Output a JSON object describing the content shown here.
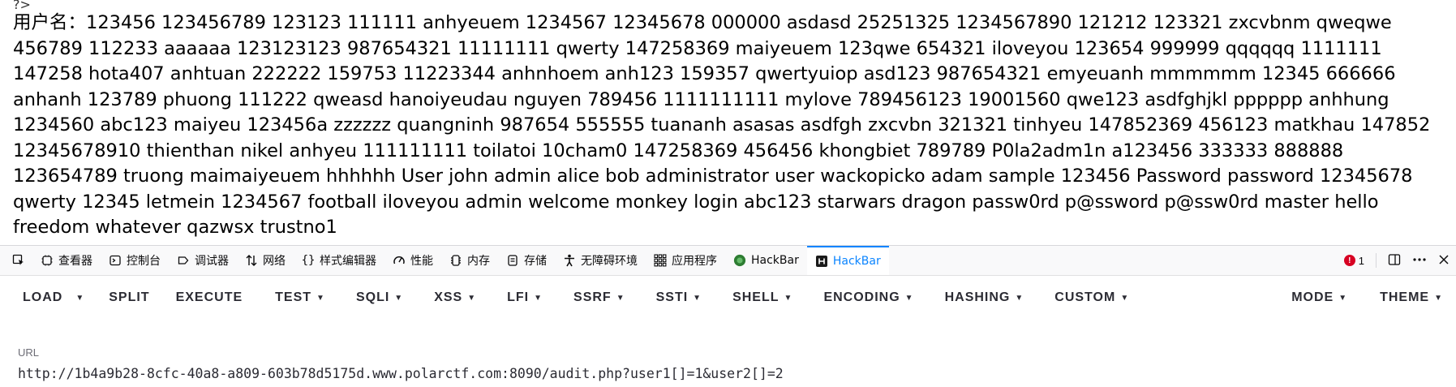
{
  "page": {
    "partial_top_text": "?>",
    "body_text": "用户名：123456 123456789 123123 111111 anhyeuem 1234567 12345678 000000 asdasd 25251325 1234567890 121212 123321 zxcvbnm qweqwe 456789 112233 aaaaaa 123123123 987654321 11111111 qwerty 147258369 maiyeuem 123qwe 654321 iloveyou 123654 999999 qqqqqq 1111111 147258 hota407 anhtuan 222222 159753 11223344 anhnhoem anh123 159357 qwertyuiop asd123 987654321 emyeuanh mmmmmm 12345 666666 anhanh 123789 phuong 111222 qweasd hanoiyeudau nguyen 789456 1111111111 mylove 789456123 19001560 qwe123 asdfghjkl pppppp anhhung 1234560 abc123 maiyeu 123456a zzzzzz quangninh 987654 555555 tuananh asasas asdfgh zxcvbn 321321 tinhyeu 147852369 456123 matkhau 147852 12345678910 thienthan nikel anhyeu 111111111 toilatoi 10cham0 147258369 456456 khongbiet 789789 P0la2adm1n a123456 333333 888888 123654789 truong maimaiyeuem hhhhhh User john admin alice bob administrator user wackopicko adam sample 123456 Password password 12345678 qwerty 12345 letmein 1234567 football iloveyou admin welcome monkey login abc123 starwars dragon passw0rd p@ssword p@ssw0rd master hello freedom whatever qazwsx trustno1"
  },
  "devtools": {
    "tabs": [
      {
        "label": "查看器",
        "icon": "inspector-icon"
      },
      {
        "label": "控制台",
        "icon": "console-icon"
      },
      {
        "label": "调试器",
        "icon": "debugger-icon"
      },
      {
        "label": "网络",
        "icon": "network-icon"
      },
      {
        "label": "样式编辑器",
        "icon": "style-editor-icon"
      },
      {
        "label": "性能",
        "icon": "performance-icon"
      },
      {
        "label": "内存",
        "icon": "memory-icon"
      },
      {
        "label": "存储",
        "icon": "storage-icon"
      },
      {
        "label": "无障碍环境",
        "icon": "accessibility-icon"
      },
      {
        "label": "应用程序",
        "icon": "application-icon"
      },
      {
        "label": "HackBar",
        "icon": "hackbar-green-icon"
      },
      {
        "label": "HackBar",
        "icon": "hackbar-black-icon",
        "active": true
      }
    ],
    "error_count": "1",
    "accent": "#0a84ff",
    "error_color": "#d70022"
  },
  "hackbar": {
    "menu": [
      {
        "label": "LOAD",
        "caret": false
      },
      {
        "label": "SPLIT",
        "caret": false
      },
      {
        "label": "EXECUTE",
        "caret": false
      },
      {
        "label": "TEST",
        "caret": true
      },
      {
        "label": "SQLI",
        "caret": true
      },
      {
        "label": "XSS",
        "caret": true
      },
      {
        "label": "LFI",
        "caret": true
      },
      {
        "label": "SSRF",
        "caret": true
      },
      {
        "label": "SSTI",
        "caret": true
      },
      {
        "label": "SHELL",
        "caret": true
      },
      {
        "label": "ENCODING",
        "caret": true
      },
      {
        "label": "HASHING",
        "caret": true
      },
      {
        "label": "CUSTOM",
        "caret": true
      }
    ],
    "right_menu": [
      {
        "label": "MODE"
      },
      {
        "label": "THEME"
      }
    ],
    "url_label": "URL",
    "url_value": "http://1b4a9b28-8cfc-40a8-a809-603b78d5175d.www.polarctf.com:8090/audit.php?user1[]=1&user2[]=2"
  }
}
